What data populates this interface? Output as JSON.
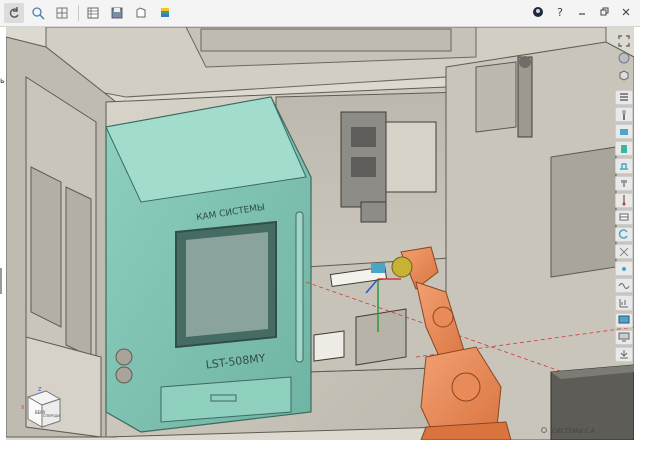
{
  "toolbar": {
    "icons": [
      "undo-icon",
      "zoom-icon",
      "grid-icon",
      "table-icon",
      "save-icon",
      "document-icon",
      "layers-icon"
    ],
    "help_label": "?"
  },
  "machine": {
    "brand_name": "КАМ СИСТЕМЫ",
    "model_label": "LST-508MY"
  },
  "view_cube": {
    "label_top": "ВЕРХ",
    "label_front": "СПЕРЕДИ",
    "axis_x": "X",
    "axis_z": "Z"
  },
  "status": {
    "text": "СИСТЕМЫ С.А."
  },
  "colors": {
    "door": "#7fc3b2",
    "robot": "#e98b58",
    "machine_body": "#cfcbc0",
    "accent_tool": "#4aa6c8"
  }
}
